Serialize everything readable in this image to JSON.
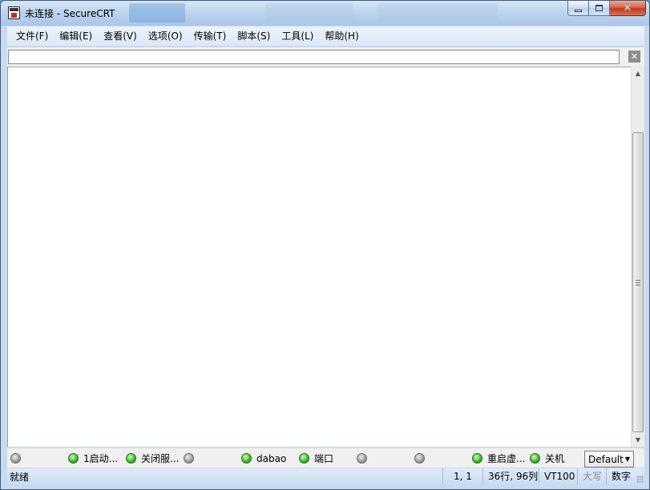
{
  "window": {
    "title": "未连接 - SecureCRT",
    "min_label": "minimize",
    "max_label": "maximize",
    "close_label": "close"
  },
  "menu": [
    {
      "label": "文件(F)"
    },
    {
      "label": "编辑(E)"
    },
    {
      "label": "查看(V)"
    },
    {
      "label": "选项(O)"
    },
    {
      "label": "传输(T)"
    },
    {
      "label": "脚本(S)"
    },
    {
      "label": "工具(L)"
    },
    {
      "label": "帮助(H)"
    }
  ],
  "command_window": {
    "value": "",
    "close_glyph": "✕"
  },
  "button_bar": {
    "buttons": [
      {
        "label": "",
        "led": "grey"
      },
      {
        "label": "1启动...",
        "led": "green"
      },
      {
        "label": "关闭服...",
        "led": "green"
      },
      {
        "label": "",
        "led": "grey"
      },
      {
        "label": "dabao",
        "led": "green"
      },
      {
        "label": "端口",
        "led": "green"
      },
      {
        "label": "",
        "led": "grey"
      },
      {
        "label": "",
        "led": "grey"
      },
      {
        "label": "重启虚...",
        "led": "green"
      },
      {
        "label": "关机",
        "led": "green"
      }
    ],
    "session_select": "Default"
  },
  "status_bar": {
    "ready": "就绪",
    "cursor": "1,   1",
    "size": "36行, 96列",
    "emulation": "VT100",
    "caps": "大写",
    "num": "数字"
  },
  "colors": {
    "titlebar": "#bcd3ee",
    "led_green": "#3fbd2a",
    "led_grey": "#9a9a9a",
    "close_red": "#c23a1f"
  }
}
